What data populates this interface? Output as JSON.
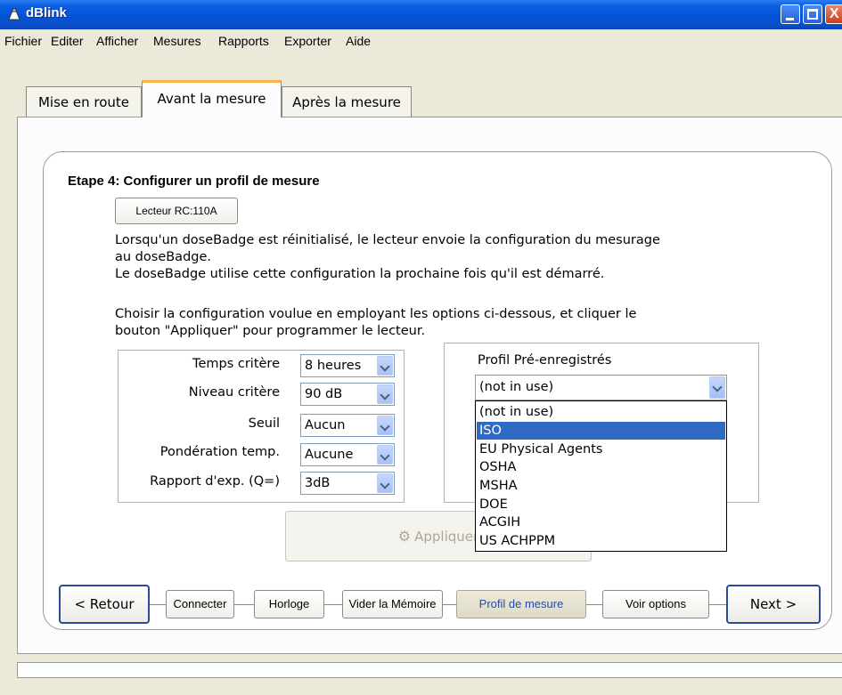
{
  "window": {
    "title": "dBlink"
  },
  "menu": [
    {
      "label": "Fichier"
    },
    {
      "label": "Editer"
    },
    {
      "label": "Afficher"
    },
    {
      "label": "Mesures"
    },
    {
      "label": "Rapports"
    },
    {
      "label": "Exporter"
    },
    {
      "label": "Aide"
    }
  ],
  "tabs": [
    {
      "label": "Mise en route"
    },
    {
      "label": "Avant la mesure"
    },
    {
      "label": "Après la mesure"
    }
  ],
  "step": {
    "title": "Etape 4: Configurer un profil de mesure",
    "reader_button": "Lecteur RC:110A",
    "para1_line1": "Lorsqu'un doseBadge est réinitialisé, le lecteur envoie la configuration du mesurage",
    "para1_line2": "au doseBadge.",
    "para1_line3": "Le doseBadge utilise cette configuration la prochaine fois qu'il est démarré.",
    "para2_line1": "Choisir la configuration voulue en employant les options ci-dessous, et cliquer le",
    "para2_line2": "bouton \"Appliquer\" pour programmer le lecteur."
  },
  "settings": [
    {
      "label": "Temps critère",
      "value": "8 heures"
    },
    {
      "label": "Niveau critère",
      "value": "90 dB"
    },
    {
      "label": "Seuil",
      "value": "Aucun"
    },
    {
      "label": "Pondération temp.",
      "value": "Aucune"
    },
    {
      "label": "Rapport d'exp. (Q=)",
      "value": "3dB"
    }
  ],
  "profiles": {
    "label": "Profil Pré-enregistrés",
    "selected": "(not in use)",
    "options": [
      "(not in use)",
      "ISO",
      "EU Physical Agents",
      "OSHA",
      "MSHA",
      "DOE",
      "ACGIH",
      "US ACHPPM"
    ],
    "highlighted": "ISO"
  },
  "apply_button": "Appliquer",
  "nav": {
    "back": "< Retour",
    "connect": "Connecter",
    "clock": "Horloge",
    "clear_memory": "Vider la Mémoire",
    "profile": "Profil de mesure",
    "view_options": "Voir options",
    "next": "Next >"
  },
  "colors": {
    "titlebar": "#0553d8",
    "selection": "#316ac5",
    "tab_highlight": "#f7b44c"
  }
}
